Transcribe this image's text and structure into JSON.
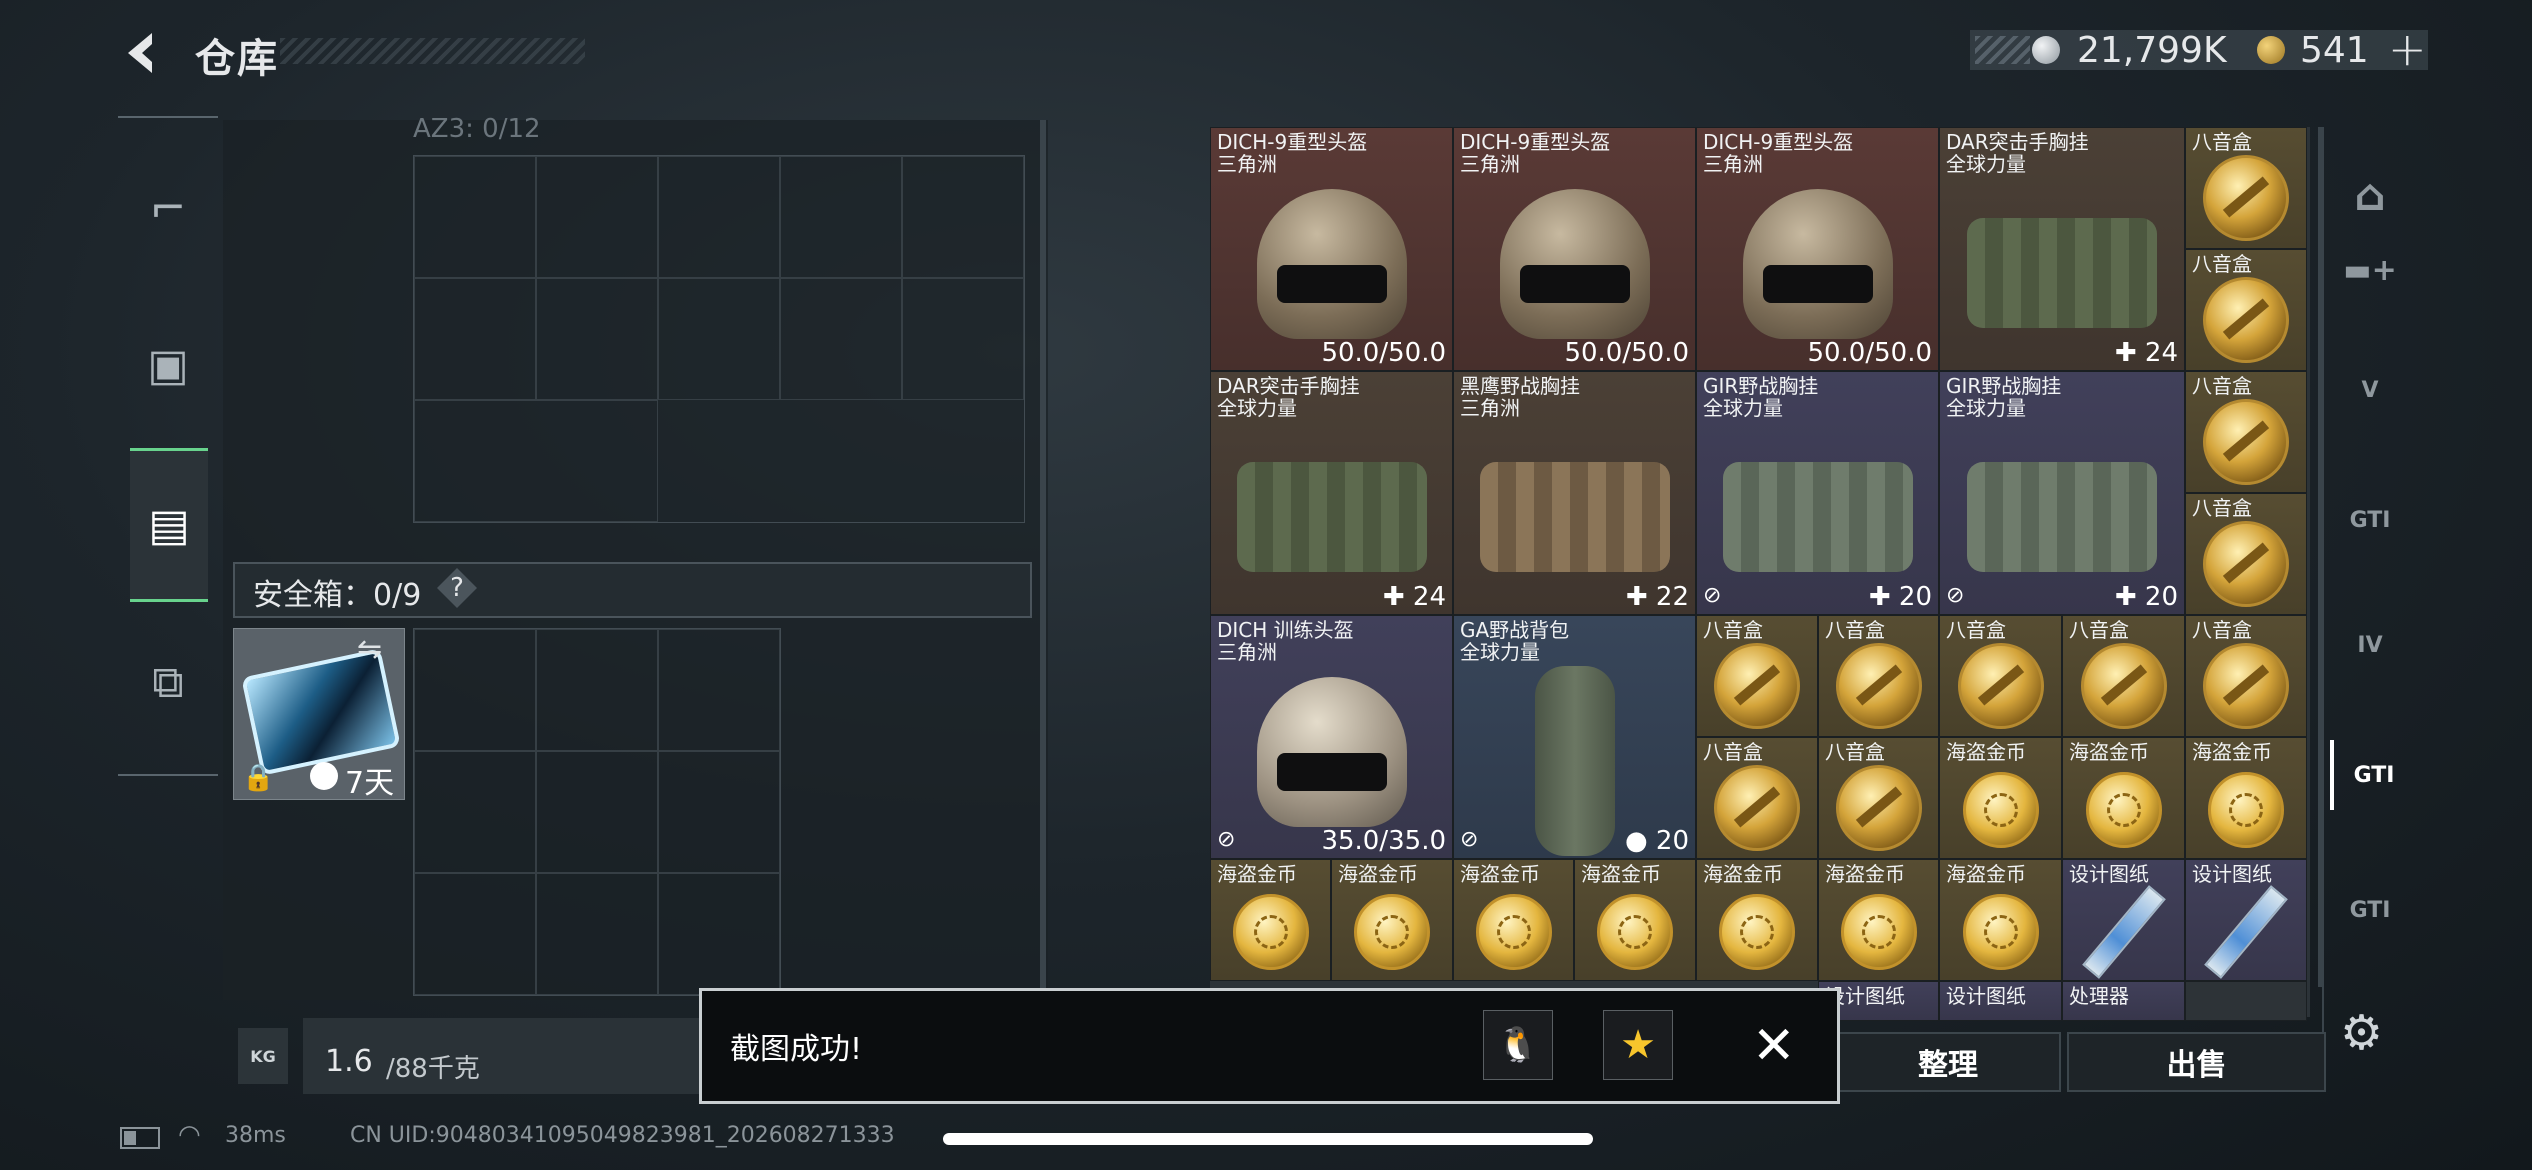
{
  "header": {
    "title": "仓库"
  },
  "currency": {
    "silver": "21,799K",
    "gold": "541",
    "add": "+"
  },
  "left_tabs": [
    "gun-icon",
    "vest-icon",
    "backpack-icon",
    "toolbox-icon"
  ],
  "container": {
    "label": "AZ3: 0/12",
    "safe_label": "安全箱：0/9",
    "help": "?",
    "case_days": "7天"
  },
  "weight": {
    "icon": "KG",
    "current": "1.6",
    "max": "/88千克"
  },
  "toast": {
    "message": "截图成功!",
    "close": "✕"
  },
  "buttons": {
    "sort": "整理",
    "sell": "出售"
  },
  "stash": [
    {
      "n1": "DICH-9重型头盔",
      "n2": "三角洲",
      "val": "50.0/50.0",
      "img": "helmet"
    },
    {
      "n1": "DICH-9重型头盔",
      "n2": "三角洲",
      "val": "50.0/50.0",
      "img": "helmet"
    },
    {
      "n1": "DICH-9重型头盔",
      "n2": "三角洲",
      "val": "50.0/50.0",
      "img": "helmet"
    },
    {
      "n1": "DAR突击手胸挂",
      "n2": "全球力量",
      "val": "24",
      "img": "bag"
    },
    {
      "n1": "DAR突击手胸挂",
      "n2": "全球力量",
      "val": "24",
      "img": "bag"
    },
    {
      "n1": "黑鹰野战胸挂",
      "n2": "三角洲",
      "val": "22",
      "img": "bag-tan"
    },
    {
      "n1": "GIR野战胸挂",
      "n2": "全球力量",
      "val": "20",
      "img": "bag-pale"
    },
    {
      "n1": "GIR野战胸挂",
      "n2": "全球力量",
      "val": "20",
      "img": "bag-pale"
    },
    {
      "n1": "DICH 训练头盔",
      "n2": "三角洲",
      "val": "35.0/35.0",
      "img": "helmet-light"
    },
    {
      "n1": "GA野战背包",
      "n2": "全球力量",
      "val": "20",
      "img": "duffel"
    }
  ],
  "small": {
    "music_box": "八音盒",
    "pirate_coin": "海盗金币",
    "blueprint": "设计图纸",
    "processor": "处理器"
  },
  "right_tabs": [
    "V",
    "GTI",
    "IV",
    "GTI"
  ],
  "status": {
    "ping": "38ms",
    "uid": "CN UID:904803410950498239​81_202608271333"
  }
}
